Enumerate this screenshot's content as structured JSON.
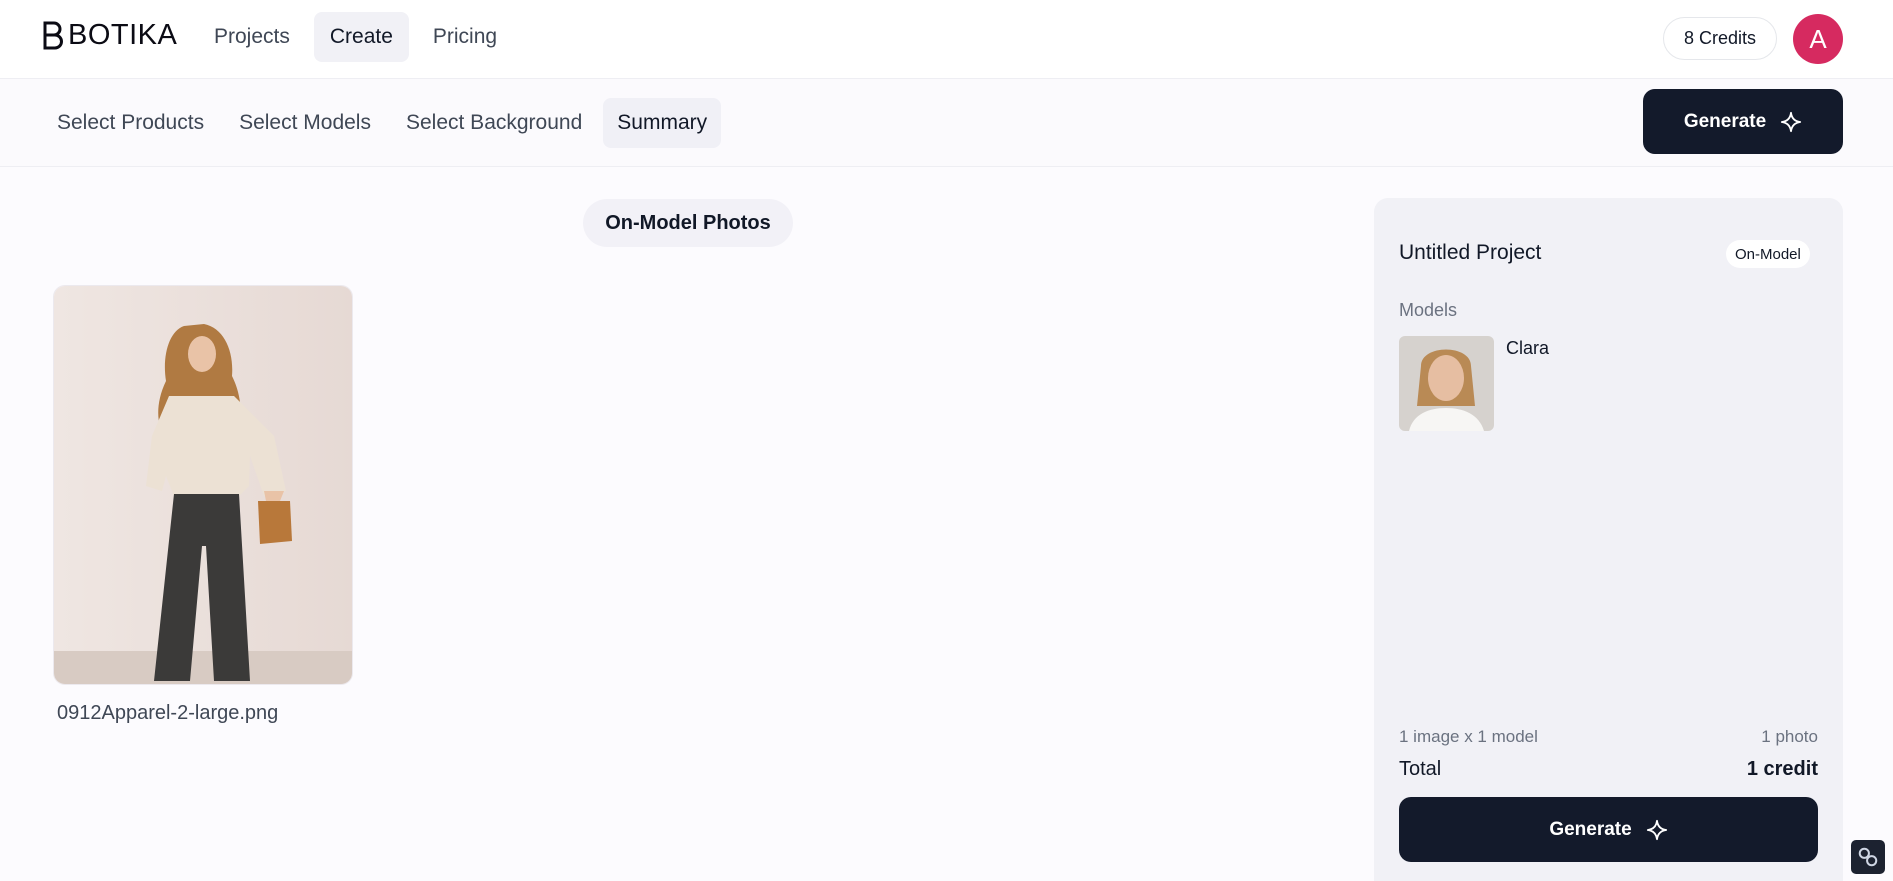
{
  "header": {
    "brand": "BOTIKA",
    "nav": [
      {
        "label": "Projects"
      },
      {
        "label": "Create"
      },
      {
        "label": "Pricing"
      }
    ],
    "credits": "8 Credits",
    "avatar_initial": "A"
  },
  "steps": {
    "items": [
      {
        "label": "Select Products"
      },
      {
        "label": "Select Models"
      },
      {
        "label": "Select Background"
      },
      {
        "label": "Summary"
      }
    ],
    "generate_label": "Generate"
  },
  "main": {
    "section_title": "On-Model Photos",
    "photo": {
      "filename": "0912Apparel-2-large.png"
    }
  },
  "summary": {
    "project_name": "Untitled Project",
    "project_type": "On-Model",
    "models_label": "Models",
    "model": {
      "name": "Clara"
    },
    "calc_formula": "1 image x 1 model",
    "calc_result": "1 photo",
    "total_label": "Total",
    "total_value": "1 credit",
    "generate_label": "Generate"
  },
  "colors": {
    "accent_dark": "#131a2b",
    "avatar": "#d62a60",
    "panel_bg": "#f1f1f6"
  }
}
